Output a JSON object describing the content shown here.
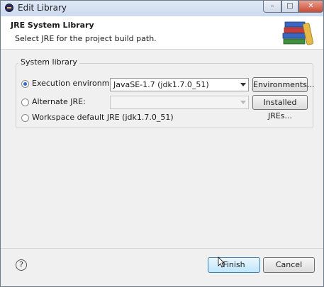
{
  "window": {
    "title": "Edit Library"
  },
  "titlebar_buttons": {
    "minimize": "–",
    "maximize": "□",
    "close": "✕"
  },
  "header": {
    "title": "JRE System Library",
    "description": "Select JRE for the project build path.",
    "icon": "library-books-icon"
  },
  "group": {
    "legend": "System library",
    "options": [
      {
        "label": "Execution environment:",
        "selected": true
      },
      {
        "label": "Alternate JRE:",
        "selected": false
      },
      {
        "label": "Workspace default JRE (jdk1.7.0_51)",
        "selected": false
      }
    ],
    "execution_env_value": "JavaSE-1.7 (jdk1.7.0_51)",
    "alternate_jre_value": "",
    "environments_button": "Environments...",
    "installed_jres_button": "Installed JREs..."
  },
  "footer": {
    "help": "?",
    "finish": "Finish",
    "cancel": "Cancel"
  },
  "colors": {
    "accent": "#3c7fb1",
    "radio_selected": "#2a6ad0"
  }
}
